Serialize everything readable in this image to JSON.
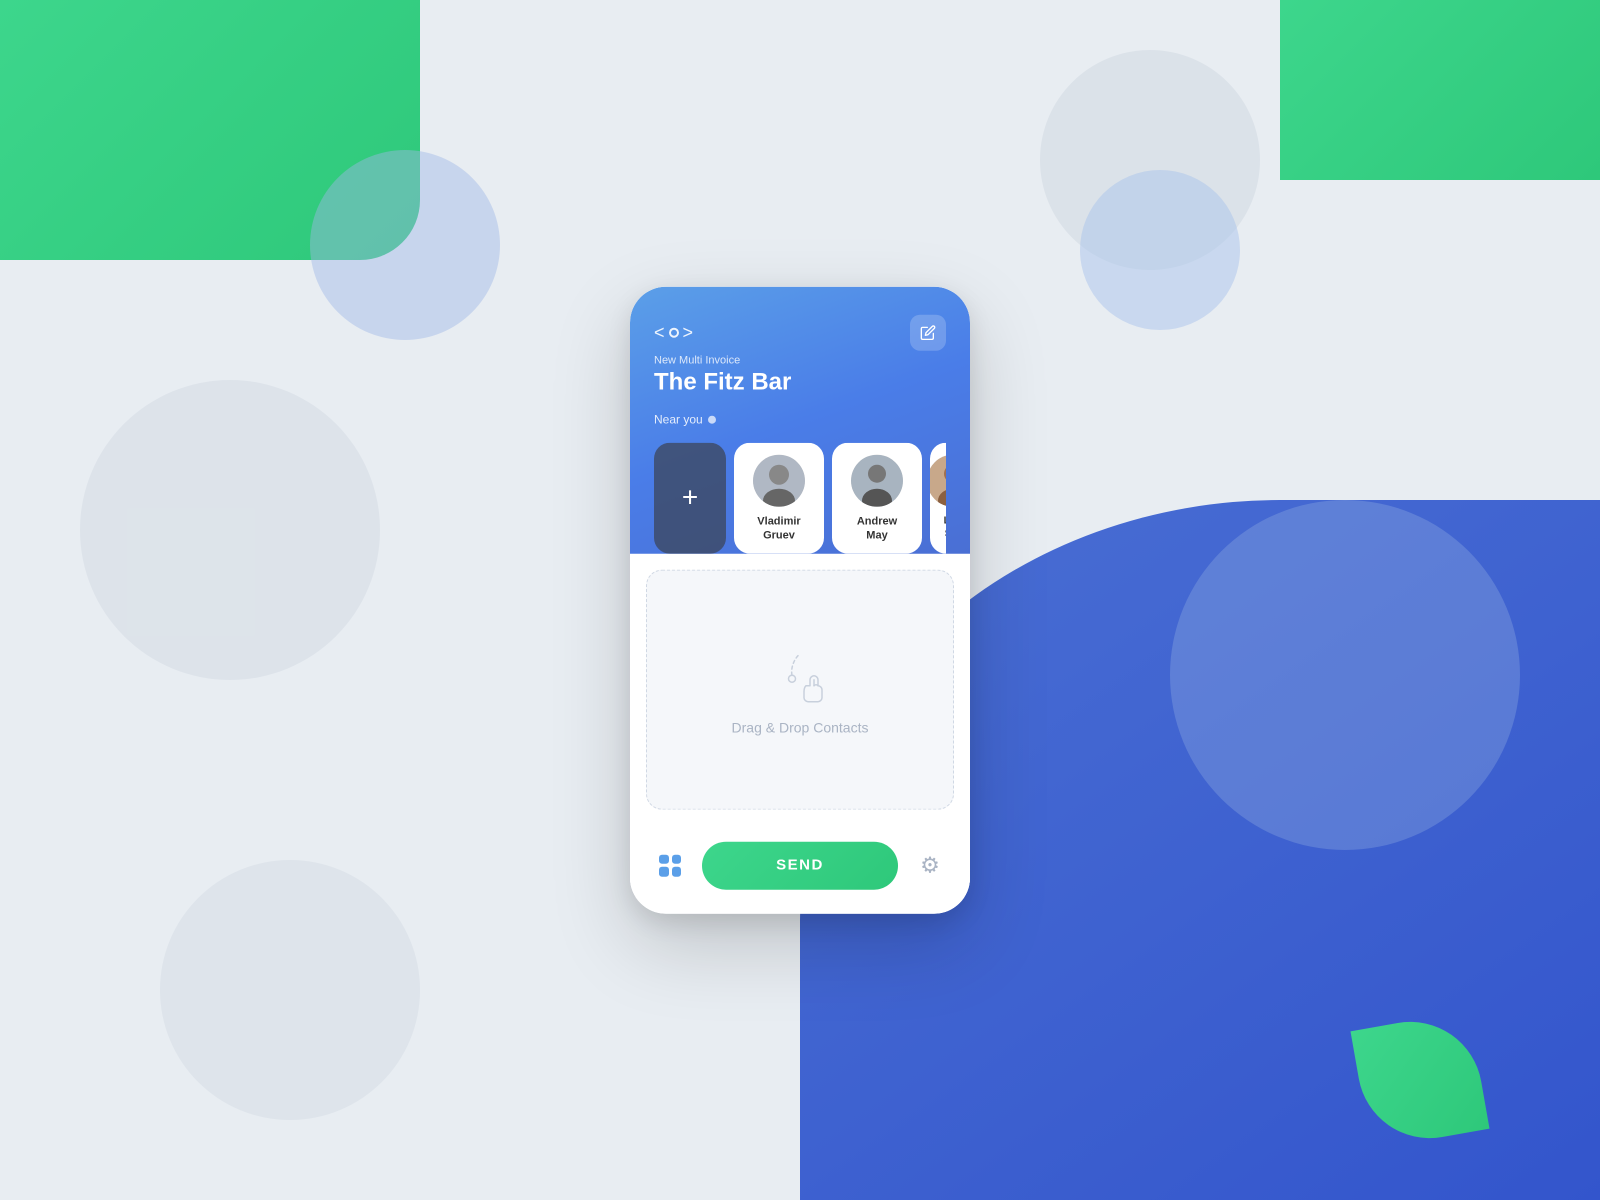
{
  "background": {
    "colors": {
      "green": "#3dd68c",
      "blue": "#4a6fd4",
      "gray": "#e8edf2"
    }
  },
  "header": {
    "subtitle": "New Multi Invoice",
    "title": "The Fitz Bar",
    "near_you": "Near you",
    "edit_label": "Edit"
  },
  "contacts": {
    "add_button_label": "+",
    "items": [
      {
        "name": "Vladimir\nGruev",
        "id": "vladimir-gruev"
      },
      {
        "name": "Andrew\nMay",
        "id": "andrew-may"
      },
      {
        "name": "Leo\nSte...",
        "id": "leo-ste"
      }
    ]
  },
  "drop_zone": {
    "text": "Drag & Drop Contacts"
  },
  "bottom_bar": {
    "send_label": "SEND"
  }
}
